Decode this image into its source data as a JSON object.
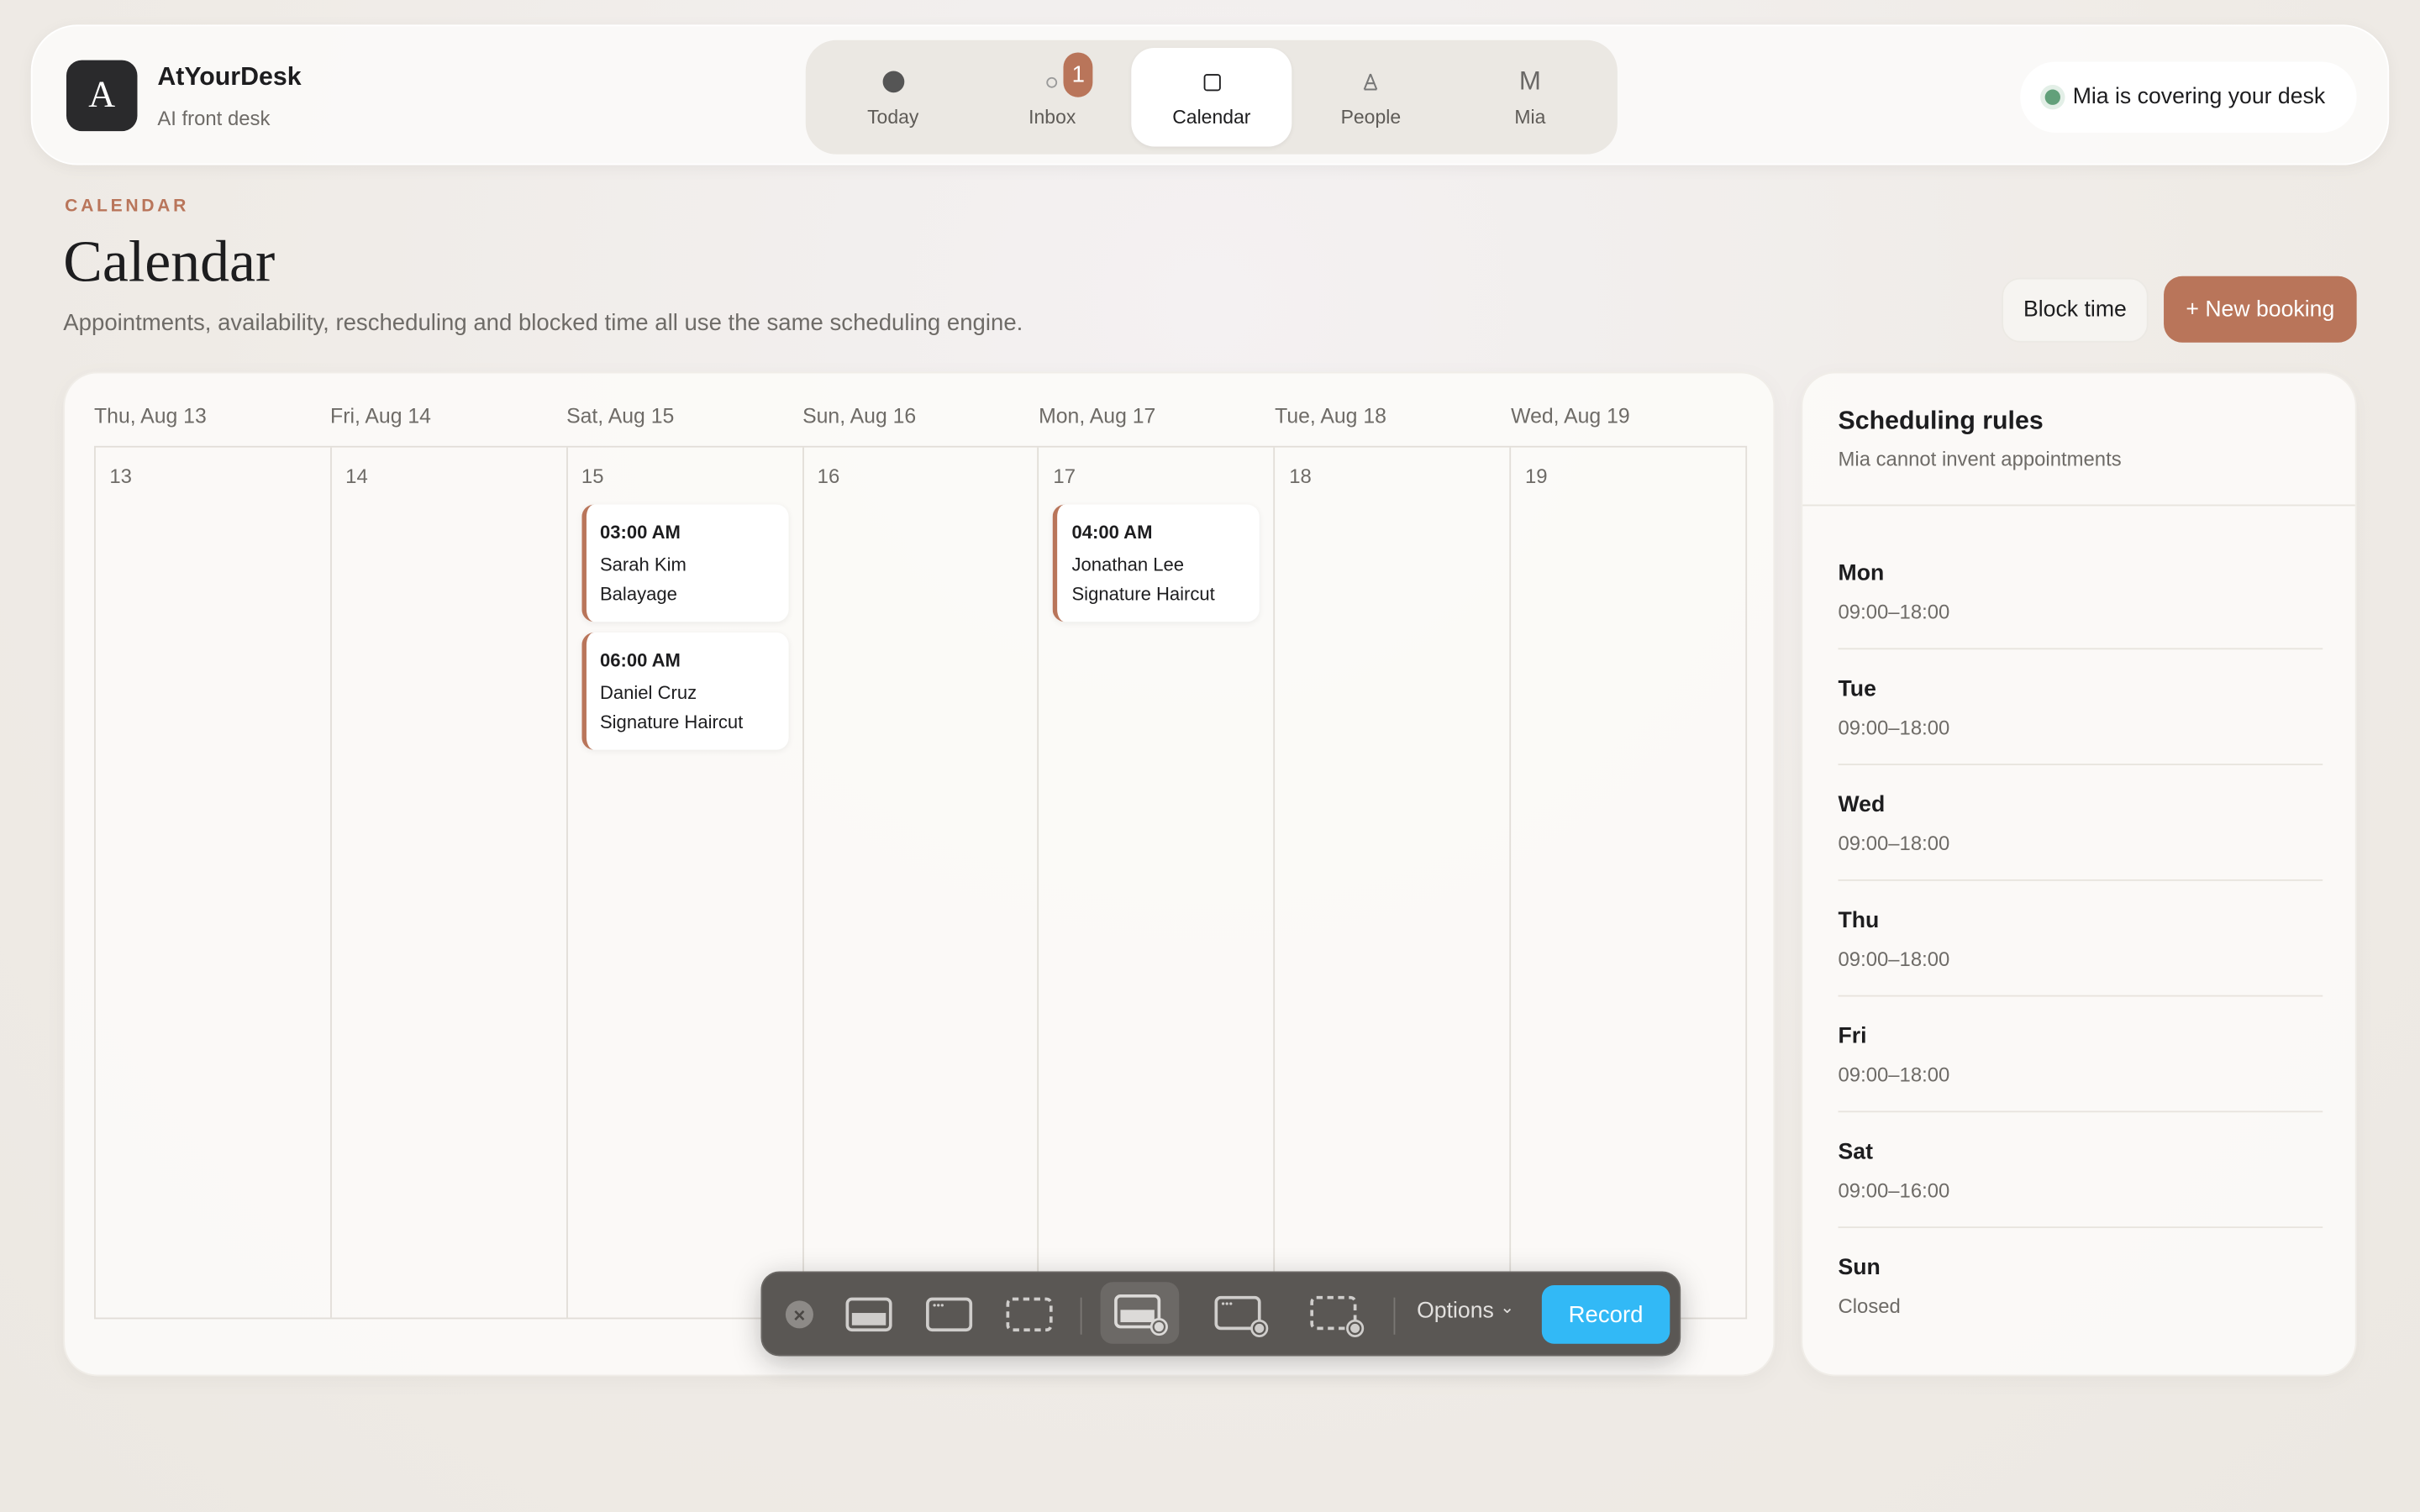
{
  "brand": {
    "logo_letter": "A",
    "name": "AtYourDesk",
    "tagline": "AI front desk"
  },
  "nav": {
    "items": [
      {
        "label": "Today",
        "icon": "dot-icon"
      },
      {
        "label": "Inbox",
        "icon": "ring-icon",
        "badge": "1"
      },
      {
        "label": "Calendar",
        "icon": "square-icon",
        "active": true
      },
      {
        "label": "People",
        "icon": "person-icon",
        "glyph": "A"
      },
      {
        "label": "Mia",
        "icon": "letter-icon",
        "glyph": "M"
      }
    ]
  },
  "status": {
    "text": "Mia is covering your desk",
    "color": "#62a07a"
  },
  "page": {
    "eyebrow": "CALENDAR",
    "title": "Calendar",
    "description": "Appointments, availability, rescheduling and blocked time all use the same scheduling engine."
  },
  "actions": {
    "block_time": "Block time",
    "new_booking": "+ New booking"
  },
  "calendar": {
    "days": [
      {
        "header": "Thu, Aug 13",
        "num": "13",
        "appointments": []
      },
      {
        "header": "Fri, Aug 14",
        "num": "14",
        "appointments": []
      },
      {
        "header": "Sat, Aug 15",
        "num": "15",
        "appointments": [
          {
            "time": "03:00 AM",
            "client": "Sarah Kim",
            "service": "Balayage"
          },
          {
            "time": "06:00 AM",
            "client": "Daniel Cruz",
            "service": "Signature Haircut"
          }
        ]
      },
      {
        "header": "Sun, Aug 16",
        "num": "16",
        "appointments": []
      },
      {
        "header": "Mon, Aug 17",
        "num": "17",
        "appointments": [
          {
            "time": "04:00 AM",
            "client": "Jonathan Lee",
            "service": "Signature Haircut"
          }
        ]
      },
      {
        "header": "Tue, Aug 18",
        "num": "18",
        "appointments": []
      },
      {
        "header": "Wed, Aug 19",
        "num": "19",
        "appointments": []
      }
    ]
  },
  "rules": {
    "title": "Scheduling rules",
    "subtitle": "Mia cannot invent appointments",
    "days": [
      {
        "day": "Mon",
        "hours": "09:00–18:00"
      },
      {
        "day": "Tue",
        "hours": "09:00–18:00"
      },
      {
        "day": "Wed",
        "hours": "09:00–18:00"
      },
      {
        "day": "Thu",
        "hours": "09:00–18:00"
      },
      {
        "day": "Fri",
        "hours": "09:00–18:00"
      },
      {
        "day": "Sat",
        "hours": "09:00–16:00"
      },
      {
        "day": "Sun",
        "hours": "Closed"
      }
    ]
  },
  "recorder": {
    "close_glyph": "×",
    "options_label": "Options",
    "options_chevron": "⌄",
    "record_label": "Record",
    "record_color": "#32b9f6"
  },
  "accent": "#b9755a"
}
